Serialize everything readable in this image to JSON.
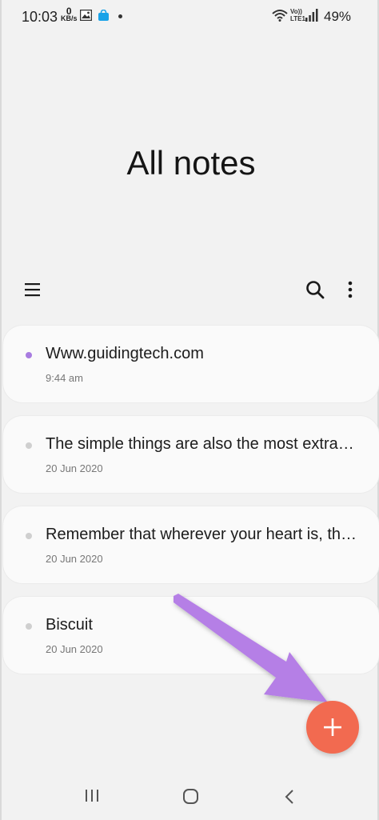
{
  "status_bar": {
    "time": "10:03",
    "data_speed_value": "0",
    "data_speed_unit": "KB/s",
    "volte_line1": "Vo))",
    "volte_line2": "LTE1",
    "battery": "49%"
  },
  "header": {
    "title": "All notes"
  },
  "toolbar": {
    "menu_icon": "hamburger-menu-icon",
    "search_icon": "search-icon",
    "more_icon": "more-vertical-icon"
  },
  "notes": [
    {
      "title": "Www.guidingtech.com",
      "date": "9:44 am",
      "dot_color": "#a87ce0"
    },
    {
      "title": "The simple things are also the most extraordinary things",
      "date": "20 Jun 2020",
      "dot_color": "#cfcfcf"
    },
    {
      "title": "Remember that wherever your heart is, there you will find your treasure",
      "date": "20 Jun 2020",
      "dot_color": "#cfcfcf"
    },
    {
      "title": "Biscuit",
      "date": "20 Jun 2020",
      "dot_color": "#cfcfcf"
    }
  ],
  "fab": {
    "icon": "plus-icon",
    "color": "#f26a50"
  },
  "annotation_arrow_color": "#b57fe6",
  "nav_bar": {
    "recents_icon": "recents-icon",
    "home_icon": "home-icon",
    "back_icon": "back-icon"
  }
}
